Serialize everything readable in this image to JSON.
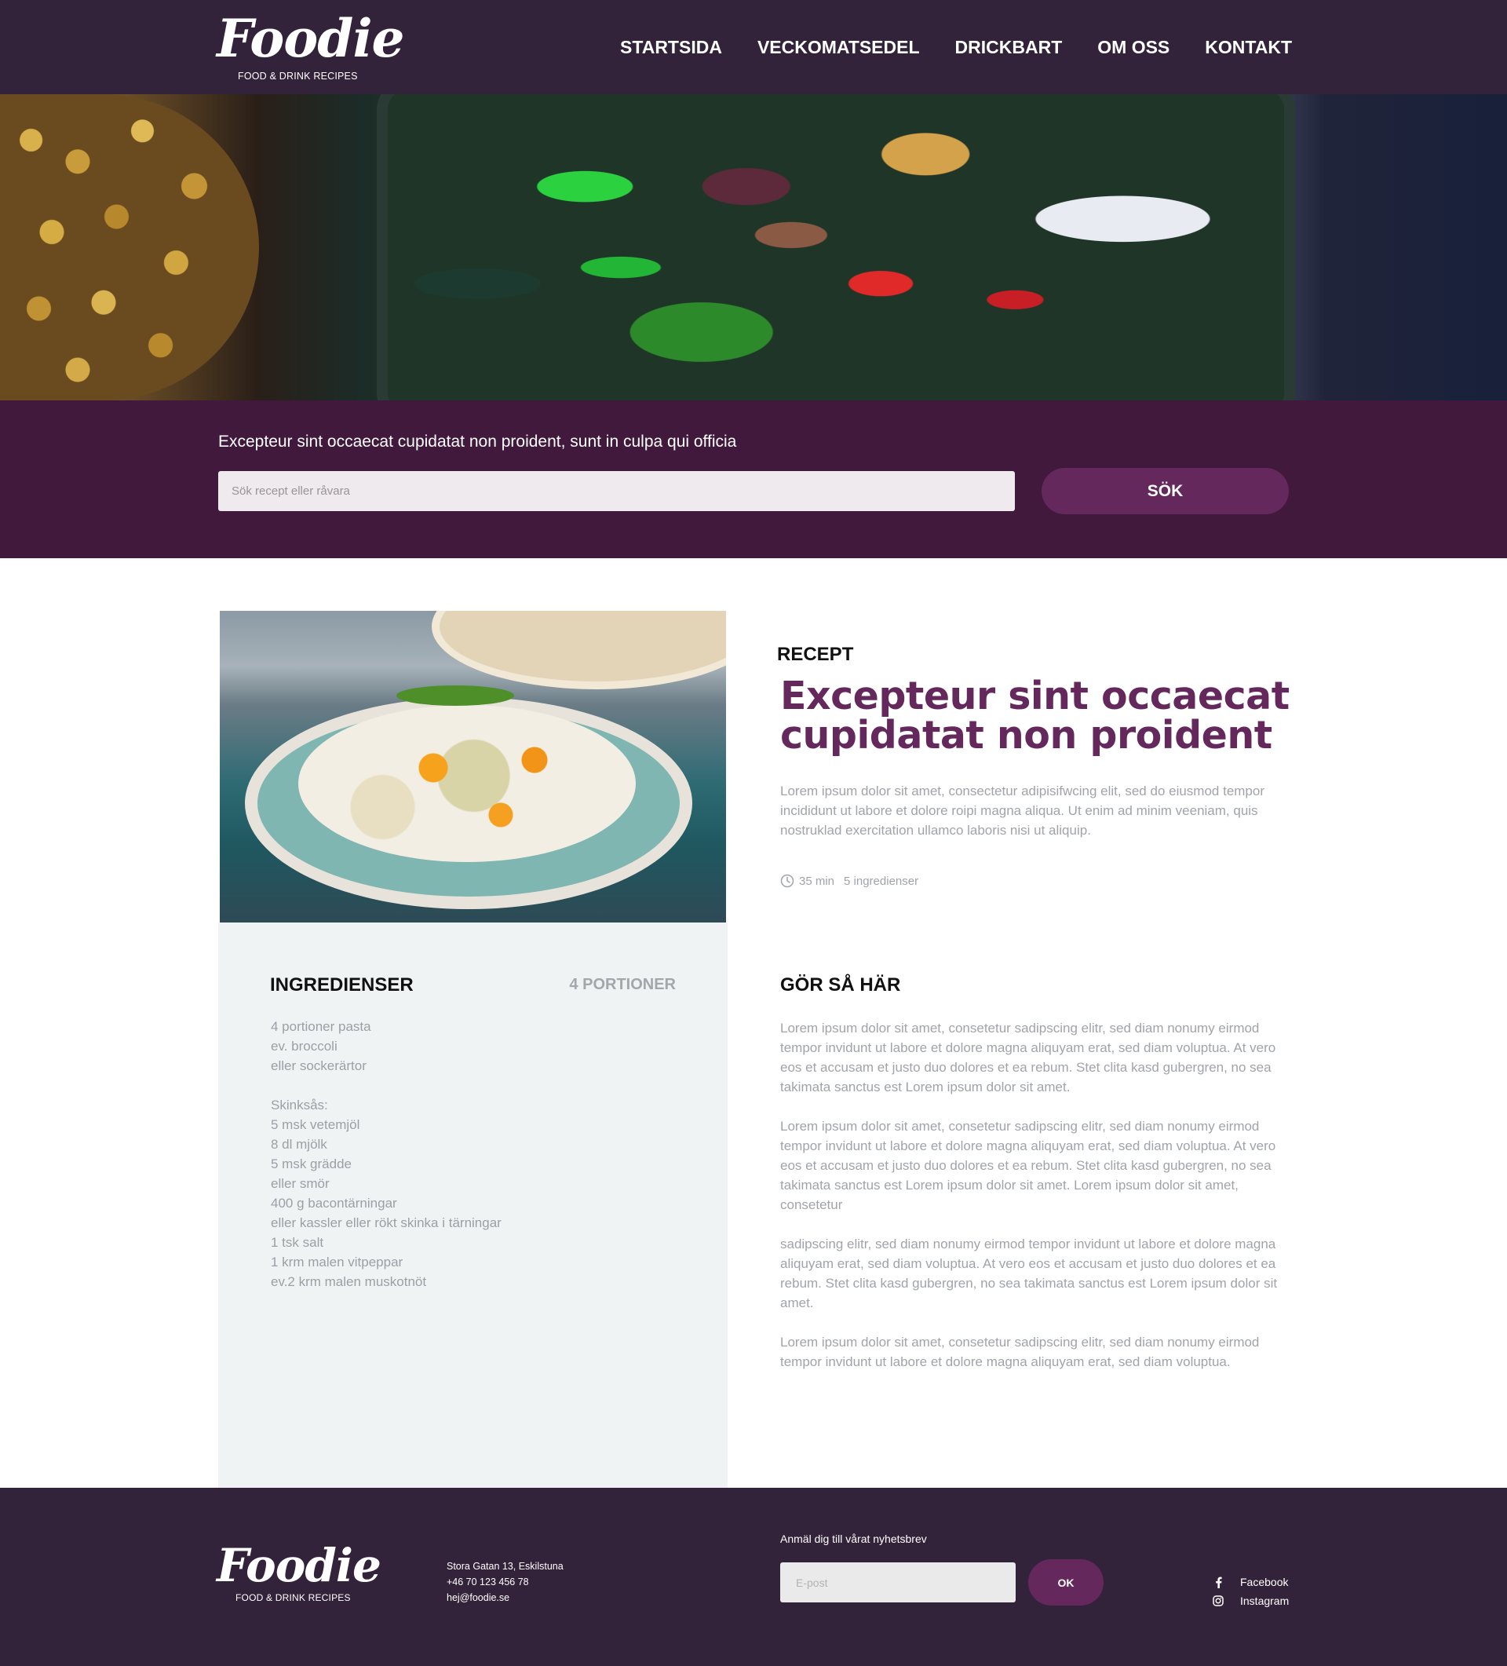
{
  "brand": {
    "name": "Foodie",
    "tagline": "FOOD & DRINK RECIPES"
  },
  "nav": {
    "items": [
      "STARTSIDA",
      "VECKOMATSEDEL",
      "DRICKBART",
      "OM OSS",
      "KONTAKT"
    ]
  },
  "search": {
    "tagline": "Excepteur sint occaecat cupidatat non proident, sunt in culpa qui officia",
    "placeholder": "Sök recept eller råvara",
    "button_label": "SÖK"
  },
  "recipe": {
    "label": "RECEPT",
    "title": "Excepteur sint occaecat cupidatat non proident",
    "description": "Lorem ipsum dolor sit amet, consectetur adipisifwcing elit, sed do eiusmod tempor incididunt ut labore et dolore roipi magna aliqua. Ut enim ad minim veeniam, quis nostruklad exercitation ullamco laboris nisi ut aliquip.",
    "time": "35 min",
    "ingredient_count": "5 ingredienser"
  },
  "ingredients": {
    "title": "INGREDIENSER",
    "portions": "4 PORTIONER",
    "items": [
      "4 portioner pasta",
      "ev. broccoli",
      "eller  sockerärtor",
      "",
      "Skinksås:",
      "5 msk vetemjöl",
      "8 dl mjölk",
      "5 msk grädde",
      "eller  smör",
      "400 g bacontärningar",
      "eller  kassler eller rökt skinka i tärningar",
      "1 tsk salt",
      "1 krm malen vitpeppar",
      "ev.2 krm malen muskotnöt"
    ]
  },
  "steps": {
    "title": "GÖR SÅ HÄR",
    "paragraphs": [
      "Lorem ipsum dolor sit amet, consetetur sadipscing elitr, sed diam nonumy eirmod tempor invidunt ut labore et dolore magna aliquyam erat, sed diam voluptua. At vero eos et accusam et justo duo dolores et ea rebum. Stet clita kasd gubergren, no sea takimata sanctus est Lorem ipsum dolor sit amet.",
      "Lorem ipsum dolor sit amet, consetetur sadipscing elitr, sed diam nonumy eirmod tempor invidunt ut labore et dolore magna aliquyam erat, sed diam voluptua. At vero eos et accusam et justo duo dolores et ea rebum. Stet clita kasd gubergren, no sea takimata sanctus est Lorem ipsum dolor sit amet. Lorem ipsum dolor sit amet, consetetur",
      "sadipscing elitr, sed diam nonumy eirmod tempor invidunt ut labore et dolore magna aliquyam erat, sed diam voluptua. At vero eos et accusam et justo duo dolores et ea rebum. Stet clita kasd gubergren, no sea takimata sanctus est Lorem ipsum dolor sit amet.",
      "Lorem ipsum dolor sit amet, consetetur sadipscing elitr, sed diam nonumy eirmod tempor invidunt ut labore et dolore magna aliquyam erat, sed diam voluptua."
    ]
  },
  "footer": {
    "address": "Stora Gatan 13, Eskilstuna",
    "phone": "+46 70 123 456 78",
    "email": "hej@foodie.se",
    "newsletter_label": "Anmäl dig till vårat nyhetsbrev",
    "newsletter_placeholder": "E-post",
    "newsletter_button": "OK",
    "social": [
      {
        "icon": "facebook-icon",
        "label": "Facebook"
      },
      {
        "icon": "instagram-icon",
        "label": "Instagram"
      }
    ]
  },
  "colors": {
    "header_bg": "#33233a",
    "search_bg": "#41193d",
    "accent": "#64285c",
    "panel_bg": "#f0f3f4",
    "muted_text": "#a0a4a9"
  }
}
